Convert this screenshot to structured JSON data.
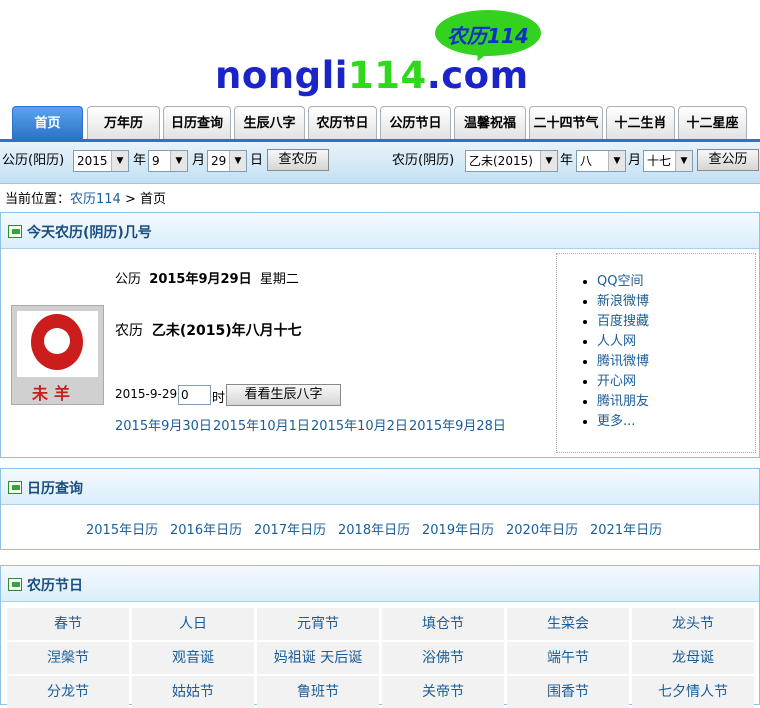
{
  "logo": {
    "bubble_text": "农历114",
    "domain_part1": "nongli",
    "domain_part2": "114",
    "domain_part3": ".com"
  },
  "nav": {
    "tabs": [
      "首页",
      "万年历",
      "日历查询",
      "生辰八字",
      "农历节日",
      "公历节日",
      "温馨祝福",
      "二十四节气",
      "十二生肖",
      "十二星座"
    ],
    "active_index": 0
  },
  "search": {
    "solar_label": "公历(阳历)",
    "solar_year": "2015",
    "year_unit": "年",
    "solar_month": "9",
    "month_unit": "月",
    "solar_day": "29",
    "day_unit": "日",
    "query_lunar_button": "查农历",
    "lunar_label": "农历(阴历)",
    "lunar_year": "乙未(2015)",
    "lunar_year_unit": "年",
    "lunar_month": "八",
    "lunar_month_unit": "月",
    "lunar_day": "十七",
    "query_solar_button": "查公历"
  },
  "breadcrumb": {
    "prefix": "当前位置：",
    "site": "农历114",
    "separator": ">",
    "current": "首页"
  },
  "today": {
    "title": "今天农历(阴历)几号",
    "solar_label": "公历",
    "solar_date": "2015年9月29日",
    "weekday": "星期二",
    "lunar_label": "农历",
    "lunar_date": "乙未(2015)年八月十七",
    "zodiac_label": "未羊",
    "date_prefix": "2015-9-29",
    "hour_value": "0",
    "hour_unit": "时",
    "bazi_button": "看看生辰八字",
    "date_links": [
      "2015年9月30日",
      "2015年10月1日",
      "2015年10月2日",
      "2015年9月28日"
    ],
    "share_links": [
      "QQ空间",
      "新浪微博",
      "百度搜藏",
      "人人网",
      "腾讯微博",
      "开心网",
      "腾讯朋友",
      "更多..."
    ]
  },
  "calendar": {
    "title": "日历查询",
    "years": [
      "2015年日历",
      "2016年日历",
      "2017年日历",
      "2018年日历",
      "2019年日历",
      "2020年日历",
      "2021年日历"
    ]
  },
  "festivals": {
    "title": "农历节日",
    "rows": [
      [
        "春节",
        "人日",
        "元宵节",
        "填仓节",
        "生菜会",
        "龙头节"
      ],
      [
        "涅槃节",
        "观音诞",
        "妈祖诞 天后诞",
        "浴佛节",
        "端午节",
        "龙母诞"
      ],
      [
        "分龙节",
        "姑姑节",
        "鲁班节",
        "关帝节",
        "围香节",
        "七夕情人节"
      ]
    ]
  },
  "colors": {
    "accent": "#2c72c6",
    "link": "#1a5c99",
    "panel_border": "#8ec2e6",
    "logo_blue": "#1a24c8",
    "logo_green": "#2fd81b"
  }
}
